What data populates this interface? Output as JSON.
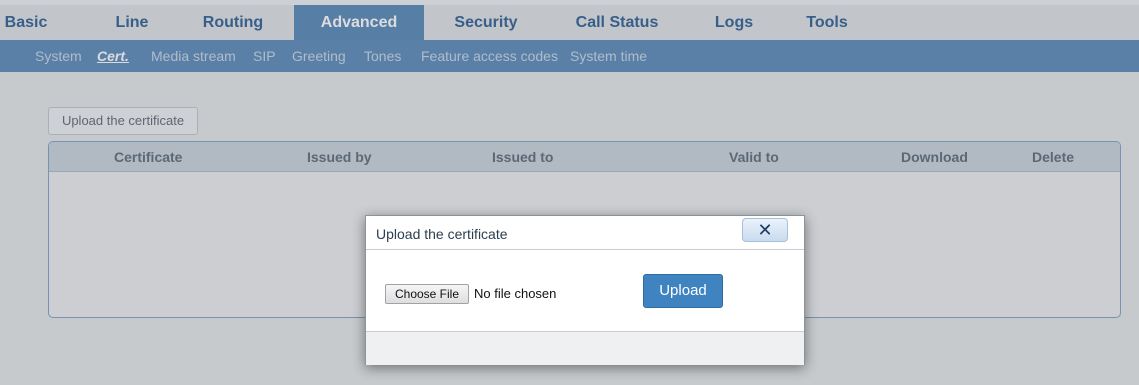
{
  "top_nav": [
    {
      "label": "Basic",
      "active": false
    },
    {
      "label": "Line",
      "active": false
    },
    {
      "label": "Routing",
      "active": false
    },
    {
      "label": "Advanced",
      "active": true
    },
    {
      "label": "Security",
      "active": false
    },
    {
      "label": "Call Status",
      "active": false
    },
    {
      "label": "Logs",
      "active": false
    },
    {
      "label": "Tools",
      "active": false
    }
  ],
  "sub_nav": [
    {
      "label": "System",
      "active": false
    },
    {
      "label": "Cert.",
      "active": true
    },
    {
      "label": "Media stream",
      "active": false
    },
    {
      "label": "SIP",
      "active": false
    },
    {
      "label": "Greeting",
      "active": false
    },
    {
      "label": "Tones",
      "active": false
    },
    {
      "label": "Feature access codes",
      "active": false
    },
    {
      "label": "System time",
      "active": false
    }
  ],
  "page": {
    "upload_button_label": "Upload the certificate",
    "table": {
      "columns": [
        "Certificate",
        "Issued by",
        "Issued to",
        "Valid to",
        "Download",
        "Delete"
      ],
      "rows": []
    }
  },
  "dialog": {
    "title": "Upload the certificate",
    "close_icon": "close-x-icon",
    "close_glyph": "✕",
    "choose_file_label": "Choose File",
    "file_status": "No file chosen",
    "upload_label": "Upload"
  },
  "colors": {
    "nav_active_bg": "#5787b7",
    "nav_text": "#2f5f93",
    "subnav_bg": "#5a8ab9",
    "primary_button": "#3f84c1"
  }
}
